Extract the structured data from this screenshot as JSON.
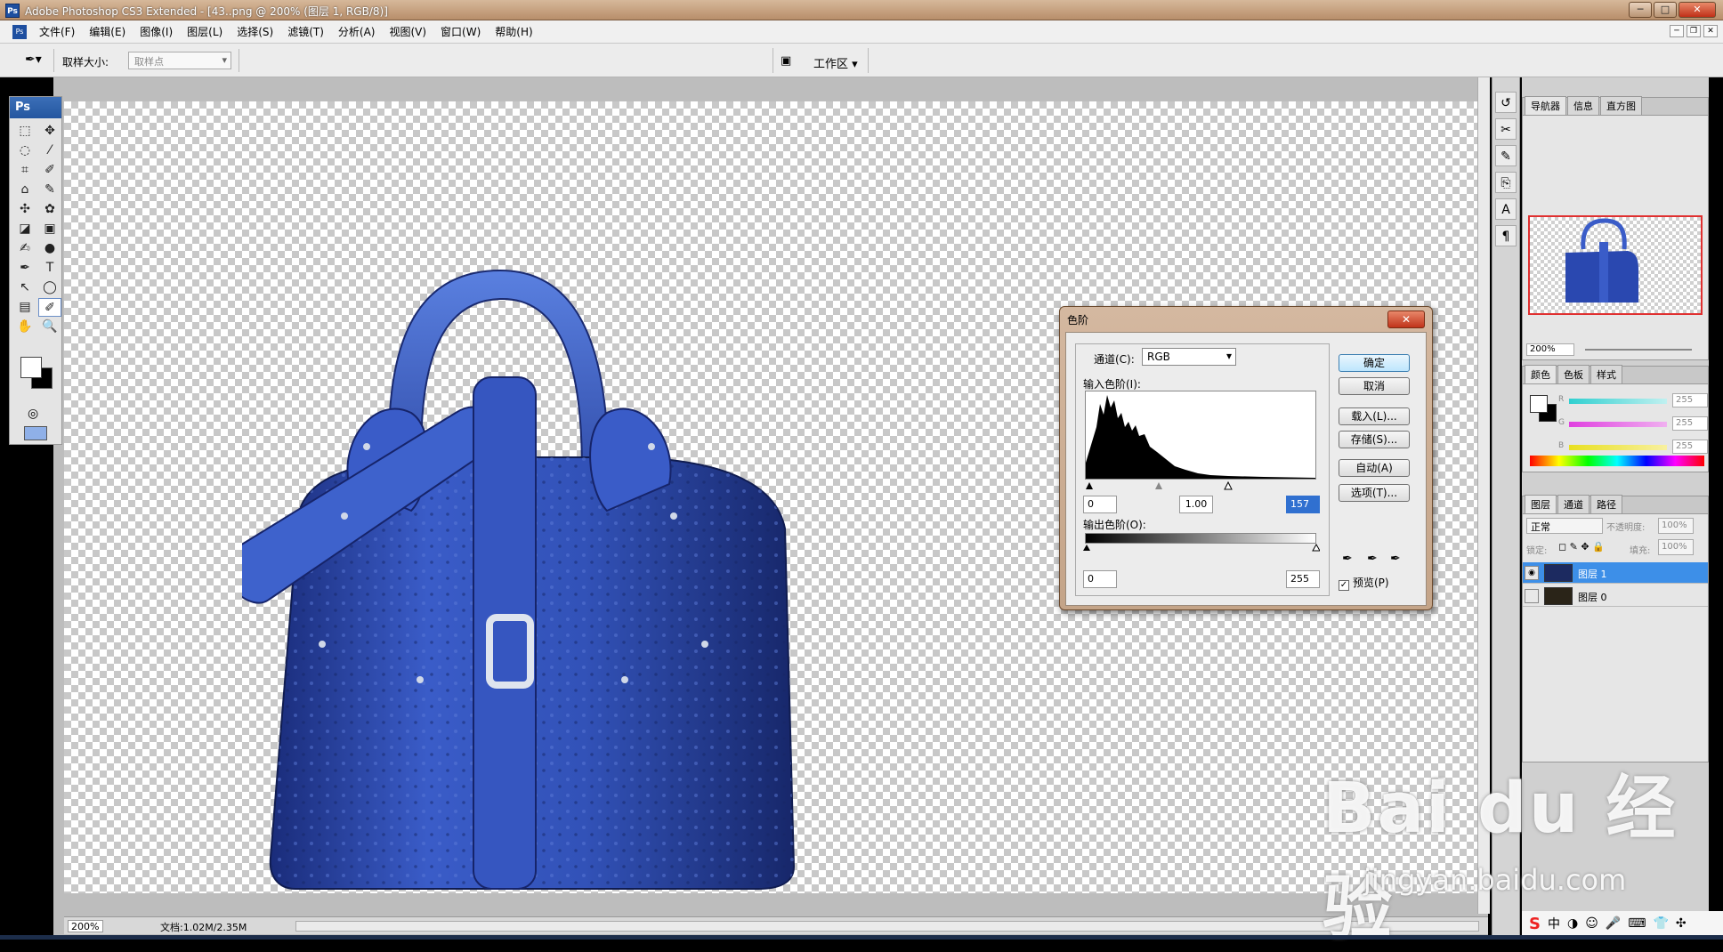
{
  "window": {
    "title": "Adobe Photoshop CS3 Extended - [43..png @ 200% (图层 1, RGB/8)]",
    "min": "─",
    "max": "□",
    "close": "✕"
  },
  "menu": [
    "文件(F)",
    "编辑(E)",
    "图像(I)",
    "图层(L)",
    "选择(S)",
    "滤镜(T)",
    "分析(A)",
    "视图(V)",
    "窗口(W)",
    "帮助(H)"
  ],
  "options": {
    "sample_label": "取样大小:",
    "sample_value": "取样点",
    "workspace": "工作区 ▾"
  },
  "toolbox": {
    "header": "Ps",
    "tools": [
      "⬚",
      "✥",
      "◌",
      "⁄",
      "⌗",
      "✐",
      "⌂",
      "✎",
      "✣",
      "✿",
      "◪",
      "▣",
      "✍",
      "●",
      "✒",
      "T",
      "↖",
      "◯",
      "▤",
      "✐",
      "✋",
      "🔍"
    ]
  },
  "status": {
    "zoom": "200%",
    "doc": "文档:1.02M/2.35M"
  },
  "navigator": {
    "tabs": [
      "导航器",
      "信息",
      "直方图"
    ],
    "zoom": "200%"
  },
  "color_panel": {
    "tabs": [
      "颜色",
      "色板",
      "样式"
    ],
    "channels": [
      {
        "name": "R",
        "value": "255",
        "color": "#30d0d0"
      },
      {
        "name": "G",
        "value": "255",
        "color": "#e040e0"
      },
      {
        "name": "B",
        "value": "255",
        "color": "#e8e020"
      }
    ]
  },
  "layers_panel": {
    "tabs": [
      "图层",
      "通道",
      "路径"
    ],
    "blend": "正常",
    "opacity_label": "不透明度:",
    "opacity": "100%",
    "lock_label": "锁定:",
    "fill_label": "填充:",
    "fill": "100%",
    "layers": [
      {
        "name": "图层 1",
        "selected": true
      },
      {
        "name": "图层 0",
        "selected": false
      }
    ]
  },
  "levels": {
    "title": "色阶",
    "close": "✕",
    "channel_label": "通道(C):",
    "channel": "RGB",
    "input_label": "输入色阶(I):",
    "input": [
      "0",
      "1.00",
      "157"
    ],
    "output_label": "输出色阶(O):",
    "output": [
      "0",
      "255"
    ],
    "buttons": {
      "ok": "确定",
      "cancel": "取消",
      "load": "载入(L)...",
      "save": "存储(S)...",
      "auto": "自动(A)",
      "options": "选项(T)..."
    },
    "preview": "预览(P)"
  },
  "watermark": {
    "brand": "Bai du 经验",
    "url": "jingyan.baidu.com"
  }
}
